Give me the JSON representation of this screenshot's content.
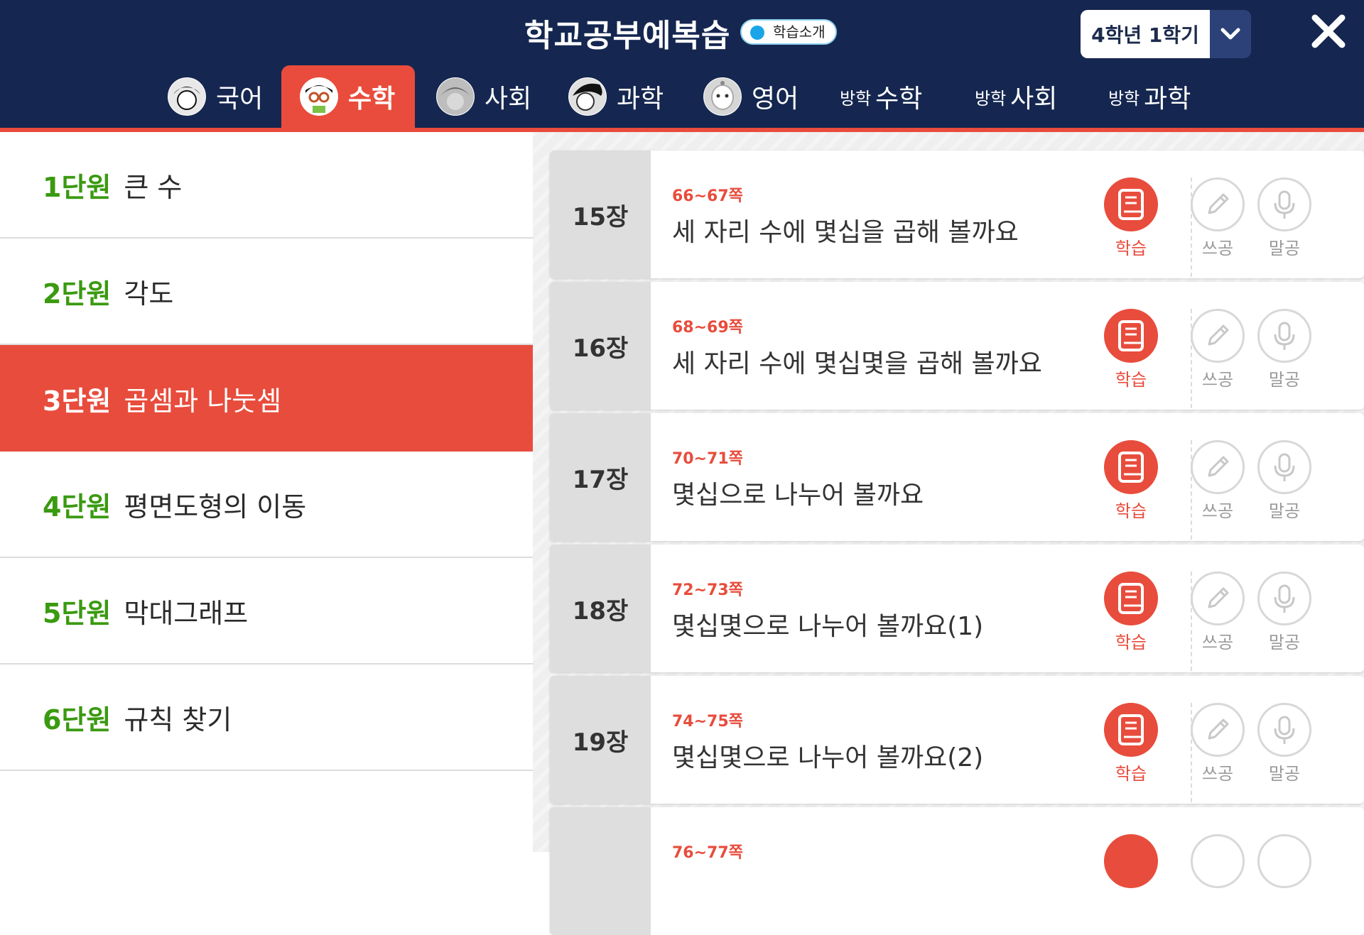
{
  "header": {
    "title": "학교공부예복습",
    "intro_badge": "학습소개",
    "grade": "4학년 1학기"
  },
  "tabs": [
    {
      "label": "국어",
      "prefix": "",
      "active": false
    },
    {
      "label": "수학",
      "prefix": "",
      "active": true
    },
    {
      "label": "사회",
      "prefix": "",
      "active": false
    },
    {
      "label": "과학",
      "prefix": "",
      "active": false
    },
    {
      "label": "영어",
      "prefix": "",
      "active": false
    },
    {
      "label": "수학",
      "prefix": "방학",
      "active": false
    },
    {
      "label": "사회",
      "prefix": "방학",
      "active": false
    },
    {
      "label": "과학",
      "prefix": "방학",
      "active": false
    }
  ],
  "units": [
    {
      "num": "1단원",
      "name": "큰 수",
      "active": false
    },
    {
      "num": "2단원",
      "name": "각도",
      "active": false
    },
    {
      "num": "3단원",
      "name": "곱셈과 나눗셈",
      "active": true
    },
    {
      "num": "4단원",
      "name": "평면도형의 이동",
      "active": false
    },
    {
      "num": "5단원",
      "name": "막대그래프",
      "active": false
    },
    {
      "num": "6단원",
      "name": "규칙 찾기",
      "active": false
    }
  ],
  "chapters": [
    {
      "chapter": "15장",
      "pages": "66~67쪽",
      "title": "세 자리 수에 몇십을 곱해 볼까요"
    },
    {
      "chapter": "16장",
      "pages": "68~69쪽",
      "title": "세 자리 수에 몇십몇을 곱해 볼까요"
    },
    {
      "chapter": "17장",
      "pages": "70~71쪽",
      "title": "몇십으로 나누어 볼까요"
    },
    {
      "chapter": "18장",
      "pages": "72~73쪽",
      "title": "몇십몇으로 나누어 볼까요(1)"
    },
    {
      "chapter": "19장",
      "pages": "74~75쪽",
      "title": "몇십몇으로 나누어 볼까요(2)"
    },
    {
      "chapter": "",
      "pages": "76~77쪽",
      "title": ""
    }
  ],
  "actions": {
    "study": "학습",
    "write": "쓰공",
    "speak": "말공"
  },
  "colors": {
    "header_bg": "#152750",
    "accent": "#e94c3c",
    "unit_number": "#3a9a10"
  }
}
